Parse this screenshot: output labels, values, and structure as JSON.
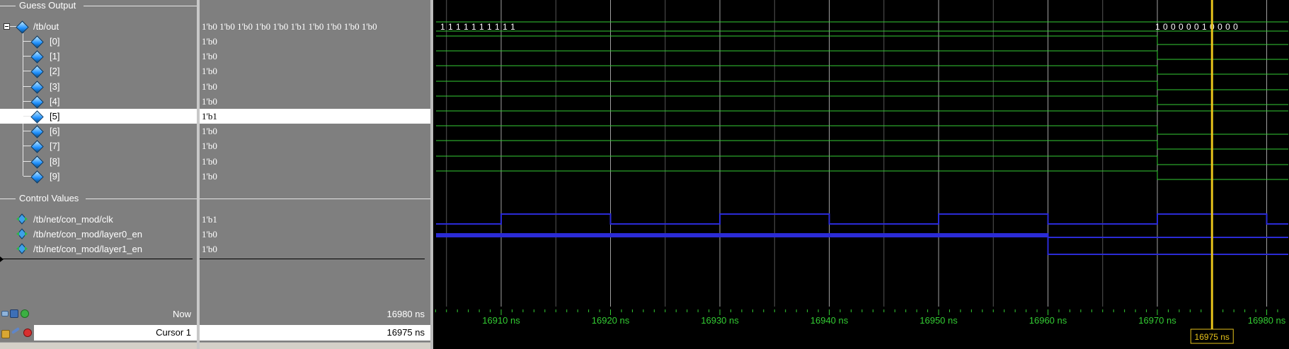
{
  "groups": {
    "guess": "Guess Output",
    "control": "Control Values"
  },
  "signals": {
    "out": {
      "name": "/tb/out",
      "value": "1'b0 1'b0 1'b0 1'b0 1'b0 1'b1 1'b0 1'b0 1'b0 1'b0"
    },
    "bits": [
      {
        "name": "[0]",
        "value": "1'b0"
      },
      {
        "name": "[1]",
        "value": "1'b0"
      },
      {
        "name": "[2]",
        "value": "1'b0"
      },
      {
        "name": "[3]",
        "value": "1'b0"
      },
      {
        "name": "[4]",
        "value": "1'b0"
      },
      {
        "name": "[5]",
        "value": "1'b1"
      },
      {
        "name": "[6]",
        "value": "1'b0"
      },
      {
        "name": "[7]",
        "value": "1'b0"
      },
      {
        "name": "[8]",
        "value": "1'b0"
      },
      {
        "name": "[9]",
        "value": "1'b0"
      }
    ],
    "controls": [
      {
        "name": "/tb/net/con_mod/clk",
        "value": "1'b1"
      },
      {
        "name": "/tb/net/con_mod/layer0_en",
        "value": "1'b0"
      },
      {
        "name": "/tb/net/con_mod/layer1_en",
        "value": "1'b0"
      }
    ]
  },
  "bus_labels": {
    "before": "1 1 1 1 1 1 1 1 1 1",
    "after": "1 0 0 0 0 0 1 0 0 0 0"
  },
  "bottom": {
    "now_label": "Now",
    "now_value": "16980 ns",
    "cursor_label": "Cursor 1",
    "cursor_value": "16975 ns"
  },
  "timeline": {
    "ticks": [
      "16910 ns",
      "16920 ns",
      "16930 ns",
      "16940 ns",
      "16950 ns",
      "16960 ns",
      "16970 ns",
      "16980 ns"
    ],
    "tick_times": [
      16910,
      16920,
      16930,
      16940,
      16950,
      16960,
      16970,
      16980
    ],
    "cursor_label": "16975 ns",
    "cursor_time": 16975
  },
  "colors": {
    "pane_bg": "#7f7f7f",
    "wave_bg": "#000000",
    "bit_wave": "#33cc33",
    "clk_wave": "#2b2bd6",
    "grid": "#8c8c8c",
    "cursor": "#e6c21a",
    "timeline_text": "#33cc33"
  },
  "icons": {
    "signal": "signal-diamond-icon",
    "control_signal": "in-out-signal-icon",
    "collapse": "minus-box-icon"
  }
}
